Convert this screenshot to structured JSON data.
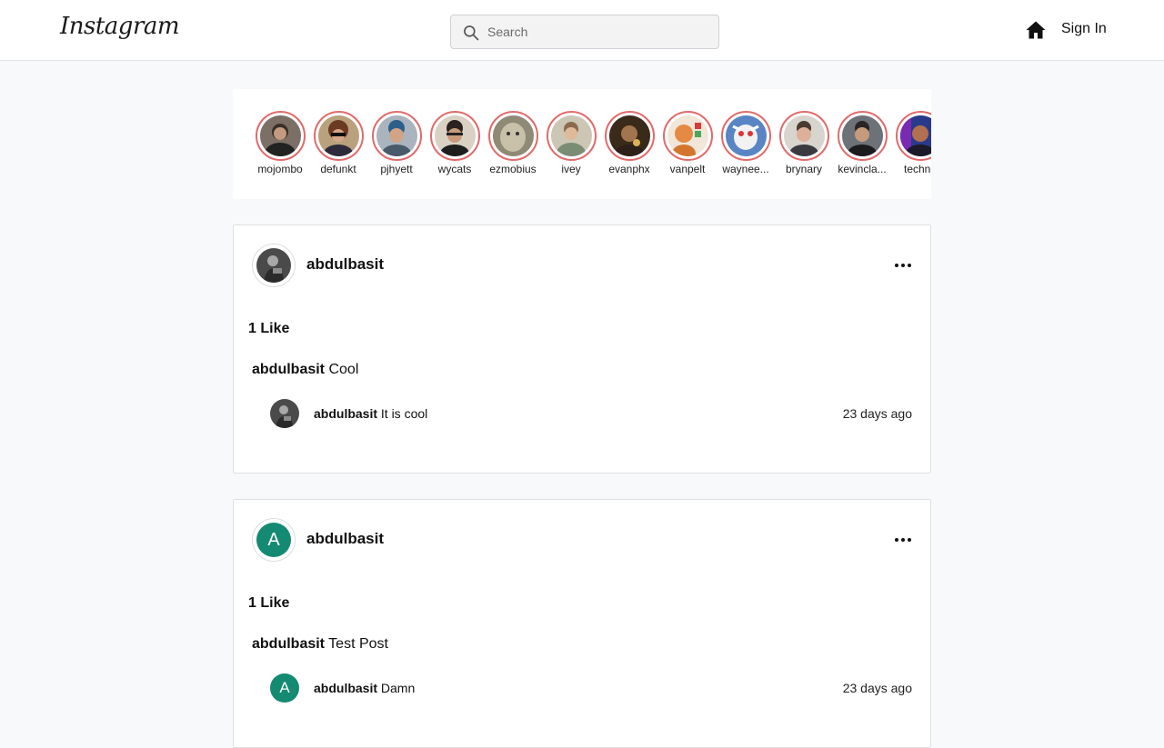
{
  "header": {
    "logo": "Instagram",
    "search_placeholder": "Search",
    "sign_in": "Sign In"
  },
  "stories": [
    {
      "username": "mojombo"
    },
    {
      "username": "defunkt"
    },
    {
      "username": "pjhyett"
    },
    {
      "username": "wycats"
    },
    {
      "username": "ezmobius"
    },
    {
      "username": "ivey"
    },
    {
      "username": "evanphx"
    },
    {
      "username": "vanpelt"
    },
    {
      "username": "waynee..."
    },
    {
      "username": "brynary"
    },
    {
      "username": "kevincla..."
    },
    {
      "username": "techno"
    }
  ],
  "posts": [
    {
      "username": "abdulbasit",
      "avatar_letter": "",
      "likes": "1 Like",
      "caption_user": "abdulbasit",
      "caption_text": "Cool",
      "comment": {
        "username": "abdulbasit",
        "text": "It is cool",
        "time": "23 days ago",
        "avatar_letter": ""
      }
    },
    {
      "username": "abdulbasit",
      "avatar_letter": "A",
      "likes": "1 Like",
      "caption_user": "abdulbasit",
      "caption_text": "Test Post",
      "comment": {
        "username": "abdulbasit",
        "text": "Damn",
        "time": "23 days ago",
        "avatar_letter": "A"
      }
    }
  ],
  "colors": {
    "story_ring": "#e26a6a",
    "letter_avatar": "#148a72"
  }
}
